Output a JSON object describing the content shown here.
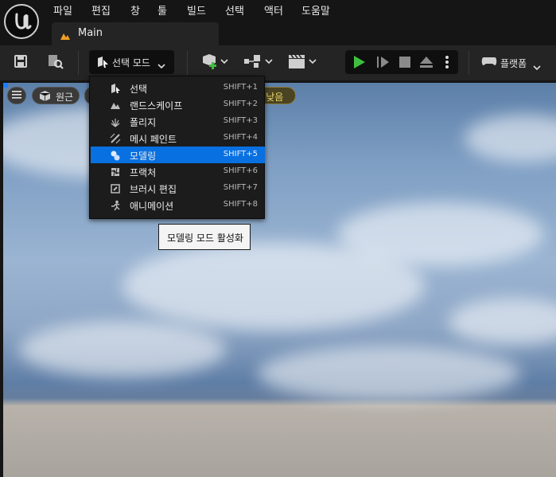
{
  "menu": {
    "items": [
      "파일",
      "편집",
      "창",
      "툴",
      "빌드",
      "선택",
      "액터",
      "도움말"
    ]
  },
  "tab": {
    "label": "Main"
  },
  "toolbar": {
    "mode_label": "선택 모드",
    "platform_label": "플랫폼"
  },
  "viewport": {
    "perspective_label": "원근",
    "scalability_label": "l: 낮음"
  },
  "mode_dropdown": {
    "items": [
      {
        "label": "선택",
        "shortcut": "SHIFT+1",
        "icon": "select-mode-icon"
      },
      {
        "label": "랜드스케이프",
        "shortcut": "SHIFT+2",
        "icon": "landscape-icon"
      },
      {
        "label": "폴리지",
        "shortcut": "SHIFT+3",
        "icon": "foliage-icon"
      },
      {
        "label": "메시 페인트",
        "shortcut": "SHIFT+4",
        "icon": "mesh-paint-icon"
      },
      {
        "label": "모델링",
        "shortcut": "SHIFT+5",
        "icon": "modeling-icon",
        "selected": true
      },
      {
        "label": "프랙처",
        "shortcut": "SHIFT+6",
        "icon": "fracture-icon"
      },
      {
        "label": "브러시 편집",
        "shortcut": "SHIFT+7",
        "icon": "brush-edit-icon"
      },
      {
        "label": "애니메이션",
        "shortcut": "SHIFT+8",
        "icon": "animation-icon"
      }
    ]
  },
  "tooltip": {
    "text": "모델링 모드 활성화"
  },
  "colors": {
    "accent": "#0870e0",
    "play_green": "#3fbf3f"
  }
}
